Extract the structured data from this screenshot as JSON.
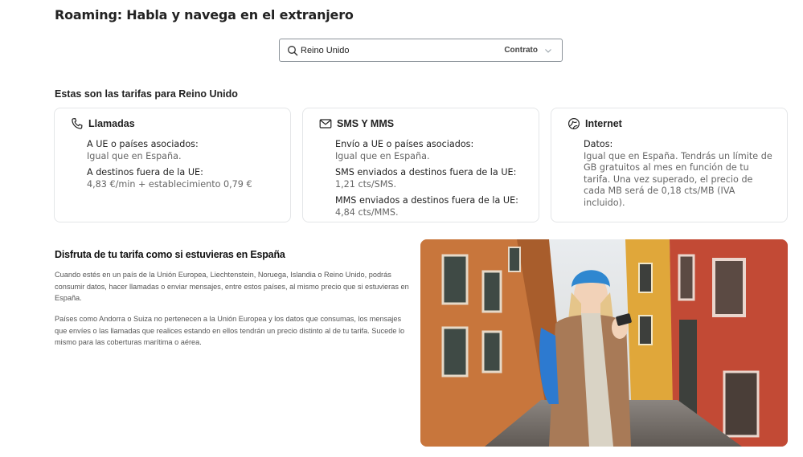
{
  "page": {
    "title": "Roaming: Habla y navega en el extranjero"
  },
  "search": {
    "country_value": "Reino Unido",
    "contract_value": "Contrato"
  },
  "rates": {
    "section_title": "Estas son las tarifas para Reino Unido",
    "cards": [
      {
        "title": "Llamadas",
        "icon": "phone-icon",
        "rows": [
          {
            "label": "A UE o países asociados:",
            "value": "Igual que en España."
          },
          {
            "label": "A destinos fuera de la UE:",
            "value": "4,83 €/min + establecimiento 0,79 €"
          }
        ]
      },
      {
        "title": "SMS Y MMS",
        "icon": "envelope-icon",
        "rows": [
          {
            "label": "Envío a UE o países asociados:",
            "value": "Igual que en España."
          },
          {
            "label": "SMS enviados a destinos fuera de la UE:",
            "value": "1,21 cts/SMS."
          },
          {
            "label": "MMS enviados a destinos fuera de la UE:",
            "value": "4,84 cts/MMS."
          }
        ]
      },
      {
        "title": "Internet",
        "icon": "globe-icon",
        "rows": [
          {
            "label": "Datos:",
            "value": "Igual que en España. Tendrás un límite de GB gratuitos al mes en función de tu tarifa. Una vez superado, el precio de cada MB será de 0,18 cts/MB (IVA incluido)."
          }
        ]
      }
    ]
  },
  "promo": {
    "title": "Disfruta de tu tarifa como si estuvieras en España",
    "paragraph_1": "Cuando estés en un país de la Unión Europea, Liechtenstein, Noruega, Islandia o Reino Unido, podrás consumir datos, hacer llamadas o enviar mensajes, entre estos países, al mismo precio que si estuvieras en España.",
    "paragraph_2": "Países como Andorra o Suiza no pertenecen a la Unión Europea y los datos que consumas, los mensajes que envíes o las llamadas que realices estando en ellos tendrán un precio distinto al de tu tarifa. Sucede lo mismo para las coberturas marítima o aérea."
  },
  "colors": {
    "text": "#222222",
    "muted": "#666666",
    "border": "#e4e6e8",
    "input_border": "#8c939a"
  }
}
